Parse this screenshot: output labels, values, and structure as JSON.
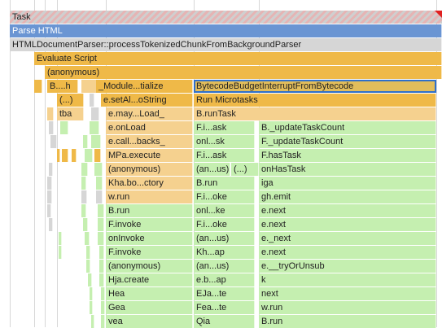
{
  "flamechart": {
    "colors": {
      "task_stripe_a": "#cfcfcf",
      "task_stripe_b": "#e5b4b4",
      "parse_html": "#6a95d3",
      "gray": "#d6d6d6",
      "orange": "#efb948",
      "light_orange": "#f5d18f",
      "selected": "#e2bd5b",
      "selection_outline": "#2f6fc9",
      "green": "#c5efb0"
    },
    "rows": [
      {
        "entries": [
          {
            "label": "Task",
            "type": "task",
            "name": "task-bar"
          }
        ]
      },
      {
        "entries": [
          {
            "label": "Parse HTML",
            "type": "parse",
            "name": "parse-html-bar"
          }
        ]
      },
      {
        "entries": [
          {
            "label": "HTMLDocumentParser::processTokenizedChunkFromBackgroundParser",
            "type": "gray",
            "name": "html-document-parser-bar"
          }
        ]
      },
      {
        "entries": [
          {
            "label": "Evaluate Script",
            "type": "orange",
            "name": "evaluate-script-bar"
          }
        ]
      },
      {
        "entries": [
          {
            "label": "(anonymous)",
            "type": "orange",
            "name": "anonymous-script-bar"
          }
        ]
      },
      {
        "entries": [
          {
            "label": "B....h",
            "type": "orange",
            "name": "frame-b-h"
          },
          {
            "label": "_Module...tialize",
            "type": "orange",
            "name": "frame-module-initialize"
          },
          {
            "label": "BytecodeBudgetInterruptFromBytecode",
            "type": "selected",
            "name": "frame-bytecode-budget-interrupt"
          }
        ]
      },
      {
        "entries": [
          {
            "label": "(...)",
            "type": "orange",
            "name": "frame-ellipsis"
          },
          {
            "label": "e.setAl...oString",
            "type": "orange",
            "name": "frame-set-al-string"
          },
          {
            "label": "Run Microtasks",
            "type": "orange",
            "name": "frame-run-microtasks"
          }
        ]
      },
      {
        "entries": [
          {
            "label": "tba",
            "type": "lorange",
            "name": "frame-tba"
          },
          {
            "label": "e.may...Load_",
            "type": "lorange",
            "name": "frame-may-load"
          },
          {
            "label": "B.runTask",
            "type": "lorange",
            "name": "frame-b-runtask"
          }
        ]
      },
      {
        "entries": [
          {
            "label": "e.onLoad",
            "type": "lorange",
            "name": "frame-onload"
          },
          {
            "label": "F.i...ask",
            "type": "green",
            "name": "frame-f-i-ask"
          },
          {
            "label": "B._updateTaskCount",
            "type": "green",
            "name": "frame-update-task-count-1"
          }
        ]
      },
      {
        "entries": [
          {
            "label": "e.call...backs_",
            "type": "lorange",
            "name": "frame-callbacks"
          },
          {
            "label": "onl...sk",
            "type": "green",
            "name": "frame-onl-sk"
          },
          {
            "label": "F._updateTaskCount",
            "type": "green",
            "name": "frame-update-task-count-2"
          }
        ]
      },
      {
        "entries": [
          {
            "label": "MPa.execute",
            "type": "lorange",
            "name": "frame-mpa-execute"
          },
          {
            "label": "F.i...ask",
            "type": "green",
            "name": "frame-f-i-ask-2"
          },
          {
            "label": "F.hasTask",
            "type": "green",
            "name": "frame-has-task"
          }
        ]
      },
      {
        "entries": [
          {
            "label": "(anonymous)",
            "type": "lorange",
            "name": "frame-anonymous-1"
          },
          {
            "label": "(an...us)",
            "type": "green",
            "name": "frame-an-us-1"
          },
          {
            "label": "(...)",
            "type": "green",
            "name": "frame-ellipsis-2"
          },
          {
            "label": "onHasTask",
            "type": "green",
            "name": "frame-on-has-task"
          }
        ]
      },
      {
        "entries": [
          {
            "label": "Kha.bo...ctory",
            "type": "lorange",
            "name": "frame-kha-factory"
          },
          {
            "label": "B.run",
            "type": "green",
            "name": "frame-b-run-1"
          },
          {
            "label": "iga",
            "type": "green",
            "name": "frame-iga"
          }
        ]
      },
      {
        "entries": [
          {
            "label": "w.run",
            "type": "lorange",
            "name": "frame-w-run-1"
          },
          {
            "label": "F.i...oke",
            "type": "green",
            "name": "frame-f-i-oke-1"
          },
          {
            "label": "gh.emit",
            "type": "green",
            "name": "frame-gh-emit"
          }
        ]
      },
      {
        "entries": [
          {
            "label": "B.run",
            "type": "green",
            "name": "frame-b-run-2"
          },
          {
            "label": "onl...ke",
            "type": "green",
            "name": "frame-onl-ke"
          },
          {
            "label": "e.next",
            "type": "green",
            "name": "frame-e-next-1"
          }
        ]
      },
      {
        "entries": [
          {
            "label": "F.invoke",
            "type": "green",
            "name": "frame-f-invoke-1"
          },
          {
            "label": "F.i...oke",
            "type": "green",
            "name": "frame-f-i-oke-2"
          },
          {
            "label": "e.next",
            "type": "green",
            "name": "frame-e-next-2"
          }
        ]
      },
      {
        "entries": [
          {
            "label": "onInvoke",
            "type": "green",
            "name": "frame-on-invoke"
          },
          {
            "label": "(an...us)",
            "type": "green",
            "name": "frame-an-us-2"
          },
          {
            "label": "e._next",
            "type": "green",
            "name": "frame-e-underscore-next"
          }
        ]
      },
      {
        "entries": [
          {
            "label": "F.invoke",
            "type": "green",
            "name": "frame-f-invoke-2"
          },
          {
            "label": "Kh...ap",
            "type": "green",
            "name": "frame-kh-ap"
          },
          {
            "label": "e.next",
            "type": "green",
            "name": "frame-e-next-3"
          }
        ]
      },
      {
        "entries": [
          {
            "label": "(anonymous)",
            "type": "green",
            "name": "frame-anonymous-2"
          },
          {
            "label": "(an...us)",
            "type": "green",
            "name": "frame-an-us-3"
          },
          {
            "label": "e.__tryOrUnsub",
            "type": "green",
            "name": "frame-try-or-unsub"
          }
        ]
      },
      {
        "entries": [
          {
            "label": "Hja.create",
            "type": "green",
            "name": "frame-hja-create"
          },
          {
            "label": "e.b...ap",
            "type": "green",
            "name": "frame-e-b-ap"
          },
          {
            "label": "k",
            "type": "green",
            "name": "frame-k"
          }
        ]
      },
      {
        "entries": [
          {
            "label": "Hea",
            "type": "green",
            "name": "frame-hea"
          },
          {
            "label": "EJa...te",
            "type": "green",
            "name": "frame-eja-te"
          },
          {
            "label": "next",
            "type": "green",
            "name": "frame-next"
          }
        ]
      },
      {
        "entries": [
          {
            "label": "Gea",
            "type": "green",
            "name": "frame-gea"
          },
          {
            "label": "Fea...te",
            "type": "green",
            "name": "frame-fea-te"
          },
          {
            "label": "w.run",
            "type": "green",
            "name": "frame-w-run-2"
          }
        ]
      },
      {
        "entries": [
          {
            "label": "vea",
            "type": "green",
            "name": "frame-vea"
          },
          {
            "label": "Qia",
            "type": "green",
            "name": "frame-qia"
          },
          {
            "label": "B.run",
            "type": "green",
            "name": "frame-b-run-3"
          }
        ]
      }
    ]
  }
}
